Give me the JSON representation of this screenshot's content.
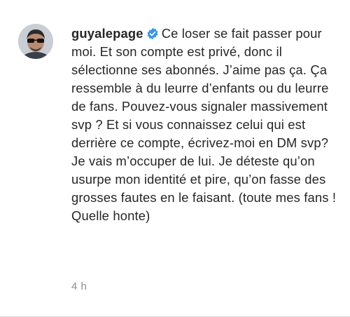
{
  "comment": {
    "username": "guyalepage",
    "verified_icon": "verified-badge-icon",
    "verified_color": "#3897f0",
    "text": "Ce loser se fait passer pour moi. Et son compte est privé, donc il sélectionne ses abonnés. J’aime pas ça. Ça ressemble à du leurre d’enfants ou du leurre de fans. Pouvez-vous signaler massivement svp ? Et si vous connaissez celui qui est derrière ce compte, écrivez-moi en DM svp? Je vais m’occuper de lui. Je déteste qu’on usurpe mon identité et pire, qu’on fasse des grosses fautes en le faisant. (toute mes fans ! Quelle honte)",
    "timestamp": "4 h"
  }
}
